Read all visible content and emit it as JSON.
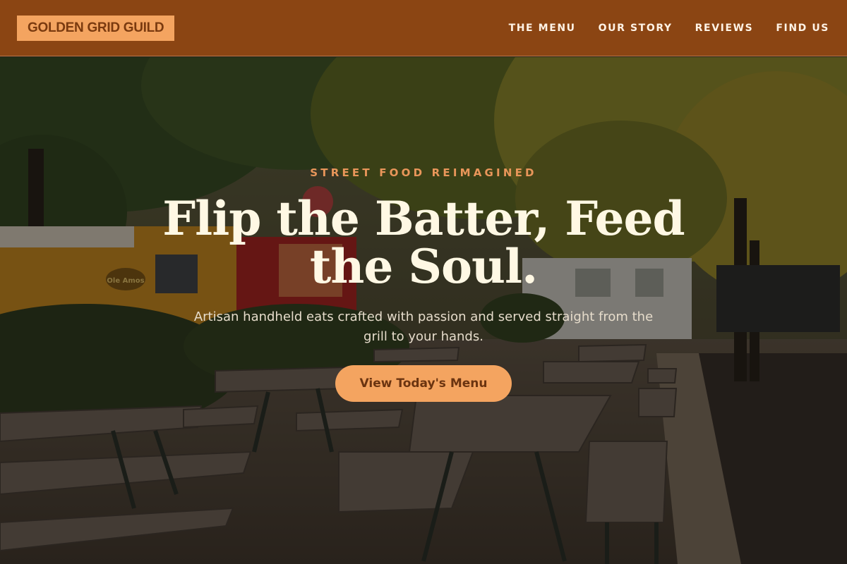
{
  "header": {
    "logo": "GOLDEN GRID GUILD",
    "nav": [
      {
        "label": "THE MENU"
      },
      {
        "label": "OUR STORY"
      },
      {
        "label": "REVIEWS"
      },
      {
        "label": "FIND US"
      }
    ]
  },
  "hero": {
    "eyebrow": "STREET FOOD REIMAGINED",
    "headline": "Flip the Batter, Feed the Soul.",
    "subtext": "Artisan handheld eats crafted with passion and served straight from the grill to your hands.",
    "cta": "View Today's Menu",
    "truck_sign": "Ole Amos"
  },
  "colors": {
    "header_bg": "#8b4513",
    "accent": "#f4a460",
    "eyebrow": "#e9965a",
    "headline": "#fff8e4"
  }
}
